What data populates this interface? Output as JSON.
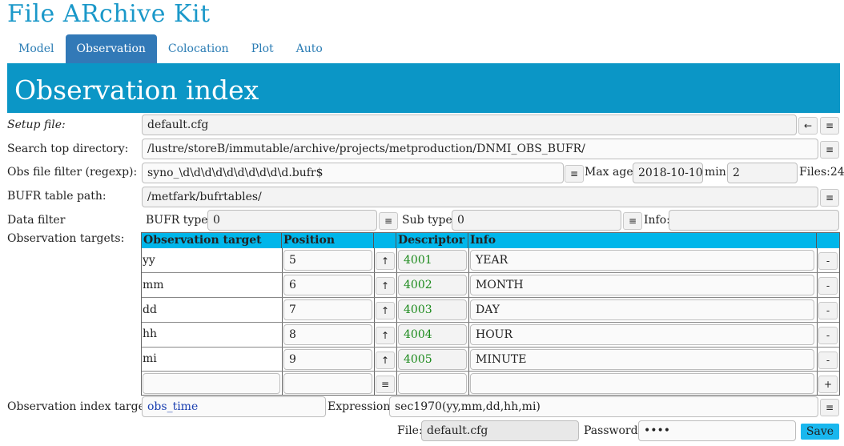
{
  "app_title": "File ARchive Kit",
  "tabs": [
    {
      "label": "Model"
    },
    {
      "label": "Observation"
    },
    {
      "label": "Colocation"
    },
    {
      "label": "Plot"
    },
    {
      "label": "Auto"
    }
  ],
  "page_title": "Observation index",
  "setup_file": {
    "label": "Setup file:",
    "value": "default.cfg",
    "back_icon": "←",
    "menu_icon": "≡"
  },
  "search_dir": {
    "label": "Search top directory:",
    "value": "/lustre/storeB/immutable/archive/projects/metproduction/DNMI_OBS_BUFR/",
    "menu_icon": "≡"
  },
  "obs_filter": {
    "label": "Obs file filter (regexp):",
    "value": "syno_\\d\\d\\d\\d\\d\\d\\d\\d\\d\\d.bufr$",
    "menu_icon": "≡",
    "max_age_label": "Max age:",
    "max_age_value": "2018-10-10",
    "min_label": "min:",
    "min_value": "2",
    "files_label": "Files:24"
  },
  "bufr_path": {
    "label": "BUFR table path:",
    "value": "/metfark/bufrtables/",
    "menu_icon": "≡"
  },
  "data_filter": {
    "label": "Data filter",
    "bufr_type_label": "BUFR type:",
    "bufr_type_value": "0",
    "sub_type_label": "Sub type:",
    "sub_type_value": "0",
    "info_label": "Info:",
    "info_value": "",
    "menu_icon": "≡"
  },
  "targets": {
    "label": "Observation targets:",
    "headers": {
      "target": "Observation target",
      "position": "Position",
      "descriptor": "Descriptor",
      "info": "Info"
    },
    "rows": [
      {
        "target": "yy",
        "position": "5",
        "descriptor": "4001",
        "info": "YEAR"
      },
      {
        "target": "mm",
        "position": "6",
        "descriptor": "4002",
        "info": "MONTH"
      },
      {
        "target": "dd",
        "position": "7",
        "descriptor": "4003",
        "info": "DAY"
      },
      {
        "target": "hh",
        "position": "8",
        "descriptor": "4004",
        "info": "HOUR"
      },
      {
        "target": "mi",
        "position": "9",
        "descriptor": "4005",
        "info": "MINUTE"
      }
    ],
    "up_icon": "↑",
    "remove_icon": "-",
    "add_icon": "+",
    "menu_icon": "≡"
  },
  "index_target": {
    "label": "Observation index target:",
    "value": "obs_time",
    "expr_label": "Expression:",
    "expr_value": "sec1970(yy,mm,dd,hh,mi)",
    "menu_icon": "≡"
  },
  "footer": {
    "file_label": "File:",
    "file_value": "default.cfg",
    "password_label": "Password:",
    "password_value": "••••",
    "save_label": "Save"
  },
  "colors": {
    "accent": "#0b96c6",
    "tab_active": "#3279b7",
    "table_header": "#00b6ea",
    "save": "#19b7ee",
    "descriptor_text": "#1b8a1b"
  }
}
